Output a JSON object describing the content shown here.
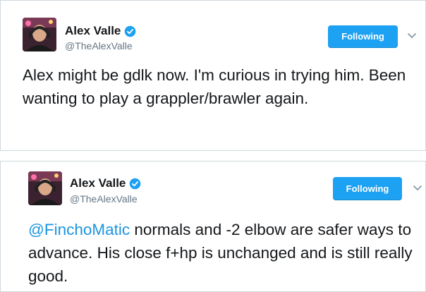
{
  "tweets": [
    {
      "author_name": "Alex Valle",
      "handle": "@TheAlexValle",
      "follow_label": "Following",
      "text": "Alex might be gdlk now. I'm curious in trying him. Been wanting to play a grappler/brawler again."
    },
    {
      "author_name": "Alex Valle",
      "handle": "@TheAlexValle",
      "follow_label": "Following",
      "mention": "@FinchoMatic",
      "text": " normals and -2 elbow are safer ways to advance. His close f+hp is unchanged and is still really good."
    }
  ],
  "colors": {
    "accent": "#1da1f2",
    "link": "#1b95e0",
    "text": "#14171a",
    "muted": "#657786",
    "border": "#cfd8dc"
  },
  "icons": {
    "verified": "verified-badge-icon",
    "chevron": "chevron-down-icon"
  }
}
